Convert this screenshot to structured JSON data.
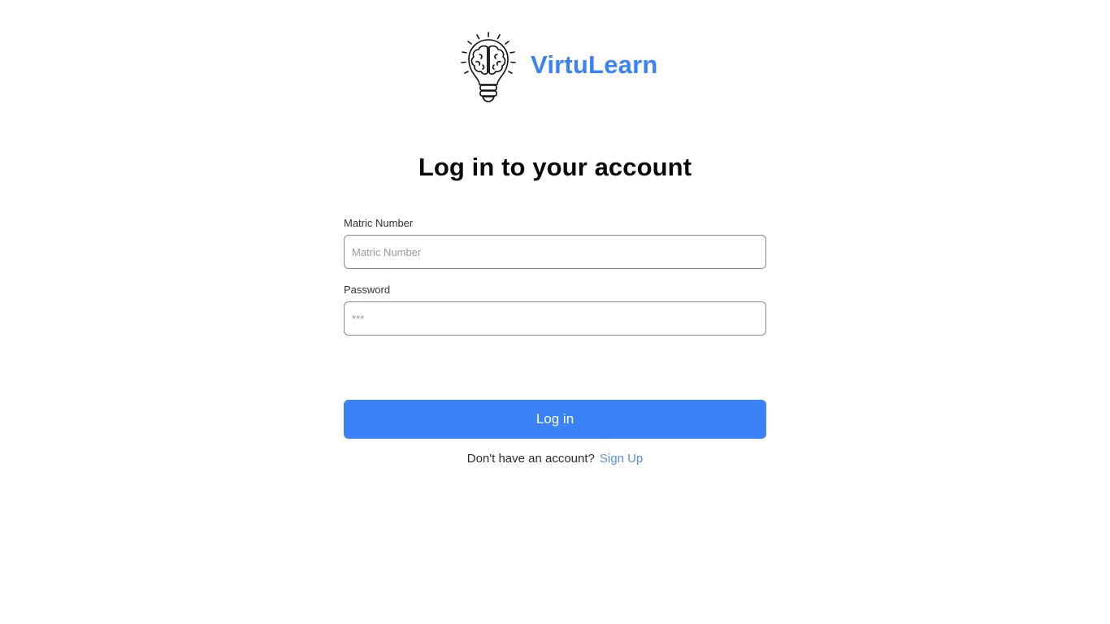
{
  "brand": {
    "name": "VirtuLearn",
    "logo_icon": "lightbulb-brain-icon",
    "color": "#3b82f6"
  },
  "login": {
    "title": "Log in to your account",
    "matric": {
      "label": "Matric Number",
      "placeholder": "Matric Number",
      "value": ""
    },
    "password": {
      "label": "Password",
      "placeholder": "***",
      "value": ""
    },
    "submit_label": "Log in",
    "submit_color": "#3b82f6",
    "signup_prompt": "Don't have an account?",
    "signup_link": "Sign Up",
    "link_color": "#5a8ee8"
  }
}
